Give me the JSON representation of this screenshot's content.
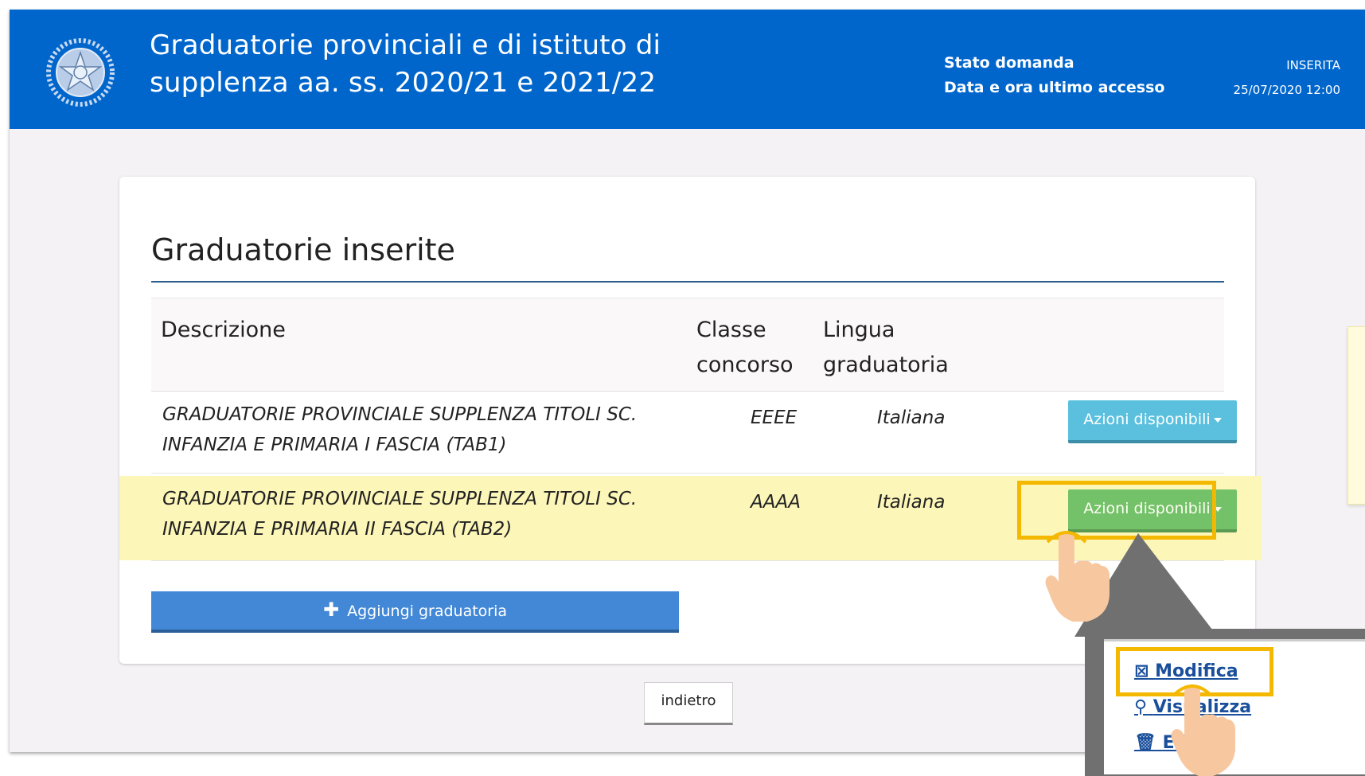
{
  "header": {
    "title_line1": "Graduatorie provinciali e di istituto di",
    "title_line2": "supplenza aa. ss. 2020/21 e 2021/22",
    "stato_label": "Stato domanda",
    "stato_value": "INSERITA",
    "accesso_label": "Data e ora ultimo accesso",
    "accesso_value": "25/07/2020 12:00"
  },
  "main": {
    "section_title": "Graduatorie inserite",
    "columns": {
      "descrizione": "Descrizione",
      "classe_l1": "Classe",
      "classe_l2": "concorso",
      "lingua_l1": "Lingua",
      "lingua_l2": "graduatoria"
    },
    "rows": [
      {
        "desc_l1": "GRADUATORIE PROVINCIALE SUPPLENZA TITOLI SC.",
        "desc_l2": "INFANZIA E PRIMARIA I FASCIA (TAB1)",
        "classe": "EEEE",
        "lingua": "Italiana",
        "action": "Azioni disponibili"
      },
      {
        "desc_l1": "GRADUATORIE PROVINCIALE SUPPLENZA TITOLI SC.",
        "desc_l2": "INFANZIA E PRIMARIA II FASCIA (TAB2)",
        "classe": "AAAA",
        "lingua": "Italiana",
        "action": "Azioni disponibili"
      }
    ],
    "add_button": "Aggiungi graduatoria",
    "back_button": "indietro"
  },
  "popup_menu": {
    "items": [
      "Modifica",
      "Visualizza",
      "Elimina"
    ]
  },
  "colors": {
    "header_bg": "#0066cc",
    "highlight": "#f5b800",
    "row_highlight": "#fcf6b9"
  }
}
